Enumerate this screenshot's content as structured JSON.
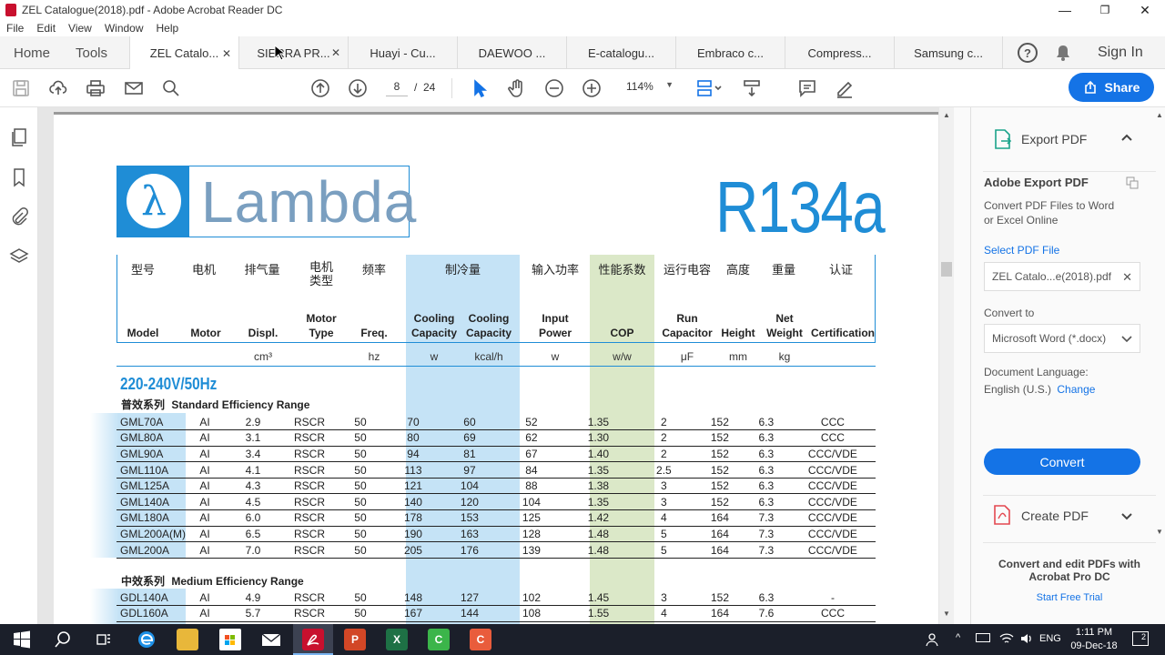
{
  "window": {
    "title": "ZEL Catalogue(2018).pdf - Adobe Acrobat Reader DC",
    "minimize": "—",
    "maximize": "❐",
    "close": "✕"
  },
  "menu": [
    "File",
    "Edit",
    "View",
    "Window",
    "Help"
  ],
  "nav": {
    "home": "Home",
    "tools": "Tools",
    "sign_in": "Sign In",
    "help": "?",
    "bell": "🔔"
  },
  "tabs": [
    {
      "label": "ZEL Catalo...",
      "close": "✕",
      "active": true
    },
    {
      "label": "SIERRA PR...",
      "close": "✕",
      "active": false
    },
    {
      "label": "Huayi - Cu...",
      "close": "",
      "active": false
    },
    {
      "label": "DAEWOO ...",
      "close": "",
      "active": false
    },
    {
      "label": "E-catalogu...",
      "close": "",
      "active": false
    },
    {
      "label": "Embraco c...",
      "close": "",
      "active": false
    },
    {
      "label": "Compress...",
      "close": "",
      "active": false
    },
    {
      "label": "Samsung c...",
      "close": "",
      "active": false
    }
  ],
  "toolbar": {
    "page_current": "8",
    "page_sep": "/",
    "page_total": "24",
    "zoom": "114%",
    "share_label": "Share"
  },
  "document": {
    "brand": "Lambda",
    "brand_symbol": "λ",
    "refrigerant": "R134a",
    "headers_cn": [
      "型号",
      "电机",
      "排气量",
      "电机\n类型",
      "频率",
      "制冷量",
      "输入功率",
      "性能系数",
      "运行电容",
      "高度",
      "重量",
      "认证"
    ],
    "headers_en": [
      "Model",
      "Motor",
      "Displ.",
      "Motor\nType",
      "Freq.",
      "Cooling\nCapacity",
      "Cooling\nCapacity",
      "Input\nPower",
      "COP",
      "Run\nCapacitor",
      "Height",
      "Net\nWeight",
      "Certification"
    ],
    "units": [
      "cm³",
      "hz",
      "w",
      "kcal/h",
      "w",
      "w/w",
      "μF",
      "mm",
      "kg"
    ],
    "section_title": "220-240V/50Hz",
    "group1_cn": "普效系列",
    "group1_en": "Standard Efficiency Range",
    "group2_cn": "中效系列",
    "group2_en": "Medium Efficiency Range",
    "rows1": [
      [
        "GML70A",
        "AI",
        "2.9",
        "RSCR",
        "50",
        "70",
        "60",
        "52",
        "1.35",
        "2",
        "152",
        "6.3",
        "CCC"
      ],
      [
        "GML80A",
        "AI",
        "3.1",
        "RSCR",
        "50",
        "80",
        "69",
        "62",
        "1.30",
        "2",
        "152",
        "6.3",
        "CCC"
      ],
      [
        "GML90A",
        "AI",
        "3.4",
        "RSCR",
        "50",
        "94",
        "81",
        "67",
        "1.40",
        "2",
        "152",
        "6.3",
        "CCC/VDE"
      ],
      [
        "GML110A",
        "AI",
        "4.1",
        "RSCR",
        "50",
        "113",
        "97",
        "84",
        "1.35",
        "2.5",
        "152",
        "6.3",
        "CCC/VDE"
      ],
      [
        "GML125A",
        "AI",
        "4.3",
        "RSCR",
        "50",
        "121",
        "104",
        "88",
        "1.38",
        "3",
        "152",
        "6.3",
        "CCC/VDE"
      ],
      [
        "GML140A",
        "AI",
        "4.5",
        "RSCR",
        "50",
        "140",
        "120",
        "104",
        "1.35",
        "3",
        "152",
        "6.3",
        "CCC/VDE"
      ],
      [
        "GML180A",
        "AI",
        "6.0",
        "RSCR",
        "50",
        "178",
        "153",
        "125",
        "1.42",
        "4",
        "164",
        "7.3",
        "CCC/VDE"
      ],
      [
        "GML200A(M)",
        "AI",
        "6.5",
        "RSCR",
        "50",
        "190",
        "163",
        "128",
        "1.48",
        "5",
        "164",
        "7.3",
        "CCC/VDE"
      ],
      [
        "GML200A",
        "AI",
        "7.0",
        "RSCR",
        "50",
        "205",
        "176",
        "139",
        "1.48",
        "5",
        "164",
        "7.3",
        "CCC/VDE"
      ]
    ],
    "rows2": [
      [
        "GDL140A",
        "AI",
        "4.9",
        "RSCR",
        "50",
        "148",
        "127",
        "102",
        "1.45",
        "3",
        "152",
        "6.3",
        "-"
      ],
      [
        "GDL160A",
        "AI",
        "5.7",
        "RSCR",
        "50",
        "167",
        "144",
        "108",
        "1.55",
        "4",
        "164",
        "7.6",
        "CCC"
      ]
    ]
  },
  "right_pane": {
    "export_title": "Export PDF",
    "adobe_export": "Adobe Export PDF",
    "convert_desc": "Convert PDF Files to Word or Excel Online",
    "select_file": "Select PDF File",
    "file_name": "ZEL Catalo...e(2018).pdf",
    "convert_to": "Convert to",
    "format": "Microsoft Word (*.docx)",
    "doc_lang_label": "Document Language:",
    "doc_lang": "English (U.S.)",
    "change": "Change",
    "convert_btn": "Convert",
    "create_pdf": "Create PDF",
    "promo": "Convert and edit PDFs with Acrobat Pro DC",
    "trial": "Start Free Trial"
  },
  "taskbar": {
    "time": "1:11 PM",
    "date": "09-Dec-18",
    "lang": "ENG",
    "notif": "2"
  },
  "colors": {
    "accent": "#1473e6",
    "brand_blue": "#1f8dd6",
    "cool_col": "#c5e3f6",
    "cop_col": "#dbe8c8",
    "taskbar": "#1b1f2a"
  }
}
